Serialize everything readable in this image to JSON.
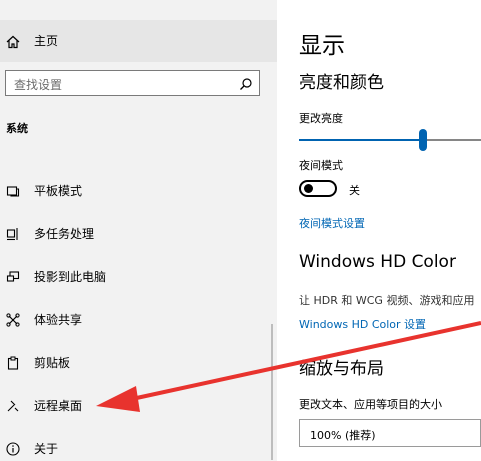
{
  "sidebar": {
    "home_label": "主页",
    "search_placeholder": "查找设置",
    "section_label": "系统",
    "items": [
      {
        "label": "平板模式",
        "icon": "tablet-icon"
      },
      {
        "label": "多任务处理",
        "icon": "multitasking-icon"
      },
      {
        "label": "投影到此电脑",
        "icon": "projecting-icon"
      },
      {
        "label": "体验共享",
        "icon": "shared-experiences-icon"
      },
      {
        "label": "剪贴板",
        "icon": "clipboard-icon"
      },
      {
        "label": "远程桌面",
        "icon": "remote-desktop-icon"
      },
      {
        "label": "关于",
        "icon": "info-icon"
      }
    ]
  },
  "main": {
    "title": "显示",
    "brightness_section": "亮度和颜色",
    "brightness_label": "更改亮度",
    "brightness_value": 0.68,
    "night_light_label": "夜间模式",
    "night_light_state": "关",
    "night_light_link": "夜间模式设置",
    "hd_color_section": "Windows HD Color",
    "hd_color_desc": "让 HDR 和 WCG 视频、游戏和应用",
    "hd_color_link": "Windows HD Color 设置",
    "scale_section": "缩放与布局",
    "scale_label": "更改文本、应用等项目的大小",
    "scale_value": "100% (推荐)"
  },
  "colors": {
    "accent": "#0063b1",
    "link": "#0066b4",
    "sidebar_bg": "#f2f2f2",
    "annotation_arrow": "#e8332e"
  }
}
